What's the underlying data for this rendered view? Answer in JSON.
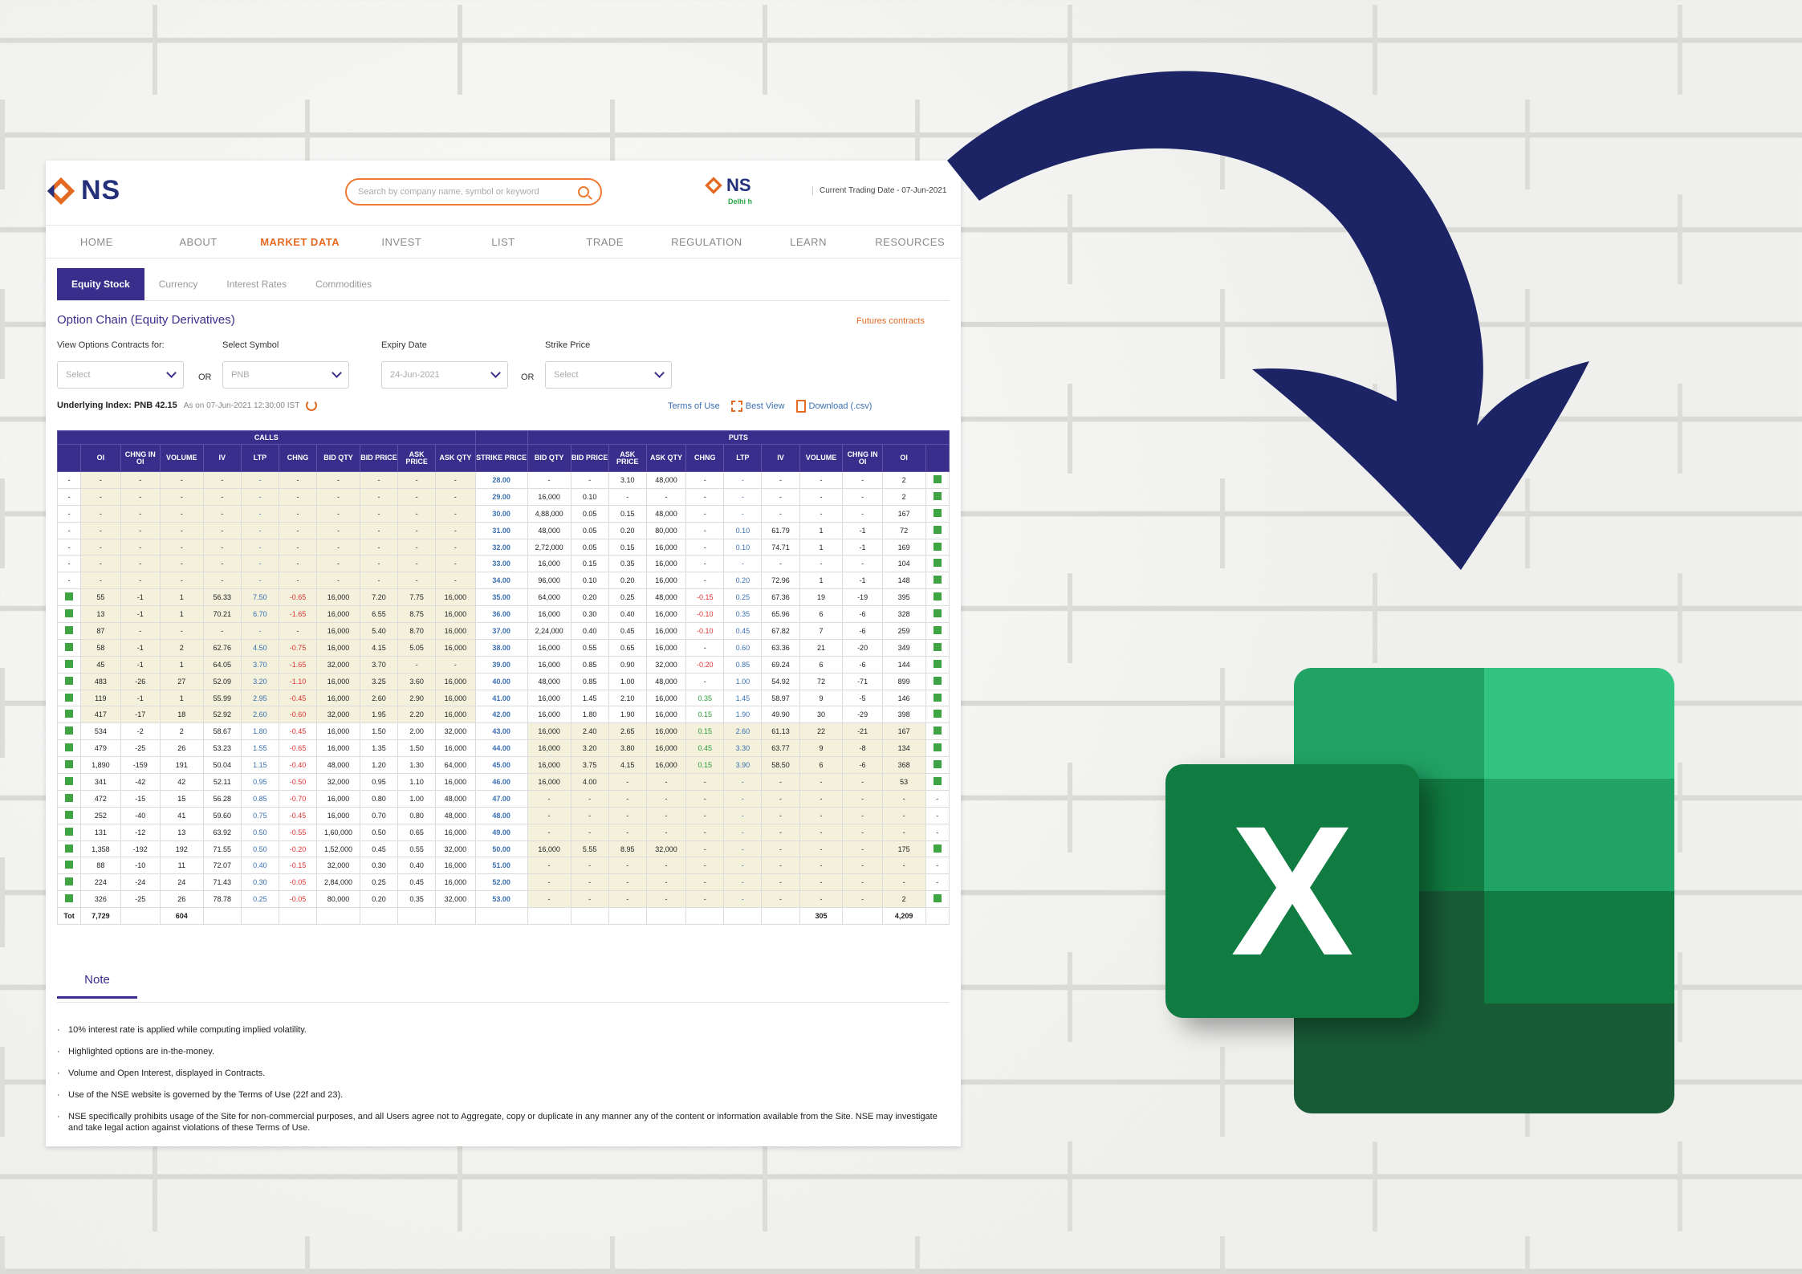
{
  "site": {
    "logo_text": "NS",
    "logo2_text": "NS",
    "logo2_tagline": "Delhi h",
    "search_placeholder": "Search by company name, symbol or keyword",
    "trading_date": "Current Trading Date - 07-Jun-2021"
  },
  "nav": [
    "HOME",
    "ABOUT",
    "MARKET DATA",
    "INVEST",
    "LIST",
    "TRADE",
    "REGULATION",
    "LEARN",
    "RESOURCES"
  ],
  "nav_active": "MARKET DATA",
  "tabs": [
    "Equity Stock",
    "Currency",
    "Interest Rates",
    "Commodities"
  ],
  "page_title": "Option Chain (Equity Derivatives)",
  "futures_link": "Futures contracts",
  "filters": {
    "contracts_label": "View Options Contracts for:",
    "contracts_value": "Select",
    "or1": "OR",
    "symbol_label": "Select Symbol",
    "symbol_value": "PNB",
    "expiry_label": "Expiry Date",
    "expiry_value": "24-Jun-2021",
    "or2": "OR",
    "strike_label": "Strike Price",
    "strike_value": "Select"
  },
  "underlying": {
    "label": "Underlying Index: PNB 42.15",
    "asof": "As on 07-Jun-2021 12:30:00 IST"
  },
  "toolbar": {
    "terms": "Terms of Use",
    "best_view": "Best View",
    "download": "Download (.csv)"
  },
  "table": {
    "calls_label": "CALLS",
    "puts_label": "PUTS",
    "columns": [
      "",
      "OI",
      "CHNG IN OI",
      "VOLUME",
      "IV",
      "LTP",
      "CHNG",
      "BID QTY",
      "BID PRICE",
      "ASK PRICE",
      "ASK QTY",
      "STRIKE PRICE",
      "BID QTY",
      "BID PRICE",
      "ASK PRICE",
      "ASK QTY",
      "CHNG",
      "LTP",
      "IV",
      "VOLUME",
      "CHNG IN OI",
      "OI",
      ""
    ],
    "itm_rows_calls_from": 7,
    "rows": [
      [
        "-",
        "-",
        "-",
        "-",
        "-",
        "-",
        "-",
        "-",
        "-",
        "-",
        "-",
        "28.00",
        "-",
        "-",
        "3.10",
        "48,000",
        "-",
        "-",
        "-",
        "-",
        "-",
        "2",
        "v"
      ],
      [
        "-",
        "-",
        "-",
        "-",
        "-",
        "-",
        "-",
        "-",
        "-",
        "-",
        "-",
        "29.00",
        "16,000",
        "0.10",
        "-",
        "-",
        "-",
        "-",
        "-",
        "-",
        "-",
        "2",
        "v"
      ],
      [
        "-",
        "-",
        "-",
        "-",
        "-",
        "-",
        "-",
        "-",
        "-",
        "-",
        "-",
        "30.00",
        "4,88,000",
        "0.05",
        "0.15",
        "48,000",
        "-",
        "-",
        "-",
        "-",
        "-",
        "167",
        "v"
      ],
      [
        "-",
        "-",
        "-",
        "-",
        "-",
        "-",
        "-",
        "-",
        "-",
        "-",
        "-",
        "31.00",
        "48,000",
        "0.05",
        "0.20",
        "80,000",
        "-",
        "0.10",
        "61.79",
        "1",
        "-1",
        "72",
        "v"
      ],
      [
        "-",
        "-",
        "-",
        "-",
        "-",
        "-",
        "-",
        "-",
        "-",
        "-",
        "-",
        "32.00",
        "2,72,000",
        "0.05",
        "0.15",
        "16,000",
        "-",
        "0.10",
        "74.71",
        "1",
        "-1",
        "169",
        "v"
      ],
      [
        "-",
        "-",
        "-",
        "-",
        "-",
        "-",
        "-",
        "-",
        "-",
        "-",
        "-",
        "33.00",
        "16,000",
        "0.15",
        "0.35",
        "16,000",
        "-",
        "-",
        "-",
        "-",
        "-",
        "104",
        "v"
      ],
      [
        "-",
        "-",
        "-",
        "-",
        "-",
        "-",
        "-",
        "-",
        "-",
        "-",
        "-",
        "34.00",
        "96,000",
        "0.10",
        "0.20",
        "16,000",
        "-",
        "0.20",
        "72.96",
        "1",
        "-1",
        "148",
        "v"
      ],
      [
        "v",
        "55",
        "-1",
        "1",
        "56.33",
        "7.50",
        "-0.65",
        "16,000",
        "7.20",
        "7.75",
        "16,000",
        "35.00",
        "64,000",
        "0.20",
        "0.25",
        "48,000",
        "-0.15",
        "0.25",
        "67.36",
        "19",
        "-19",
        "395",
        "v"
      ],
      [
        "v",
        "13",
        "-1",
        "1",
        "70.21",
        "6.70",
        "-1.65",
        "16,000",
        "6.55",
        "8.75",
        "16,000",
        "36.00",
        "16,000",
        "0.30",
        "0.40",
        "16,000",
        "-0.10",
        "0.35",
        "65.96",
        "6",
        "-6",
        "328",
        "v"
      ],
      [
        "v",
        "87",
        "-",
        "-",
        "-",
        "-",
        "-",
        "16,000",
        "5.40",
        "8.70",
        "16,000",
        "37.00",
        "2,24,000",
        "0.40",
        "0.45",
        "16,000",
        "-0.10",
        "0.45",
        "67.82",
        "7",
        "-6",
        "259",
        "v"
      ],
      [
        "v",
        "58",
        "-1",
        "2",
        "62.76",
        "4.50",
        "-0.75",
        "16,000",
        "4.15",
        "5.05",
        "16,000",
        "38.00",
        "16,000",
        "0.55",
        "0.65",
        "16,000",
        "-",
        "0.60",
        "63.36",
        "21",
        "-20",
        "349",
        "v"
      ],
      [
        "v",
        "45",
        "-1",
        "1",
        "64.05",
        "3.70",
        "-1.65",
        "32,000",
        "3.70",
        "-",
        "-",
        "39.00",
        "16,000",
        "0.85",
        "0.90",
        "32,000",
        "-0.20",
        "0.85",
        "69.24",
        "6",
        "-6",
        "144",
        "v"
      ],
      [
        "v",
        "483",
        "-26",
        "27",
        "52.09",
        "3.20",
        "-1.10",
        "16,000",
        "3.25",
        "3.60",
        "16,000",
        "40.00",
        "48,000",
        "0.85",
        "1.00",
        "48,000",
        "-",
        "1.00",
        "54.92",
        "72",
        "-71",
        "899",
        "v"
      ],
      [
        "v",
        "119",
        "-1",
        "1",
        "55.99",
        "2.95",
        "-0.45",
        "16,000",
        "2.60",
        "2.90",
        "16,000",
        "41.00",
        "16,000",
        "1.45",
        "2.10",
        "16,000",
        "0.35",
        "1.45",
        "58.97",
        "9",
        "-5",
        "146",
        "v"
      ],
      [
        "v",
        "417",
        "-17",
        "18",
        "52.92",
        "2.60",
        "-0.60",
        "32,000",
        "1.95",
        "2.20",
        "16,000",
        "42.00",
        "16,000",
        "1.80",
        "1.90",
        "16,000",
        "0.15",
        "1.90",
        "49.90",
        "30",
        "-29",
        "398",
        "v"
      ],
      [
        "v",
        "534",
        "-2",
        "2",
        "58.67",
        "1.80",
        "-0.45",
        "16,000",
        "1.50",
        "2.00",
        "32,000",
        "43.00",
        "16,000",
        "2.40",
        "2.65",
        "16,000",
        "0.15",
        "2.60",
        "61.13",
        "22",
        "-21",
        "167",
        "v"
      ],
      [
        "v",
        "479",
        "-25",
        "26",
        "53.23",
        "1.55",
        "-0.65",
        "16,000",
        "1.35",
        "1.50",
        "16,000",
        "44.00",
        "16,000",
        "3.20",
        "3.80",
        "16,000",
        "0.45",
        "3.30",
        "63.77",
        "9",
        "-8",
        "134",
        "v"
      ],
      [
        "v",
        "1,890",
        "-159",
        "191",
        "50.04",
        "1.15",
        "-0.40",
        "48,000",
        "1.20",
        "1.30",
        "64,000",
        "45.00",
        "16,000",
        "3.75",
        "4.15",
        "16,000",
        "0.15",
        "3.90",
        "58.50",
        "6",
        "-6",
        "368",
        "v"
      ],
      [
        "v",
        "341",
        "-42",
        "42",
        "52.11",
        "0.95",
        "-0.50",
        "32,000",
        "0.95",
        "1.10",
        "16,000",
        "46.00",
        "16,000",
        "4.00",
        "-",
        "-",
        "-",
        "-",
        "-",
        "-",
        "-",
        "53",
        "v"
      ],
      [
        "v",
        "472",
        "-15",
        "15",
        "56.28",
        "0.85",
        "-0.70",
        "16,000",
        "0.80",
        "1.00",
        "48,000",
        "47.00",
        "-",
        "-",
        "-",
        "-",
        "-",
        "-",
        "-",
        "-",
        "-",
        "-",
        "-"
      ],
      [
        "v",
        "252",
        "-40",
        "41",
        "59.60",
        "0.75",
        "-0.45",
        "16,000",
        "0.70",
        "0.80",
        "48,000",
        "48.00",
        "-",
        "-",
        "-",
        "-",
        "-",
        "-",
        "-",
        "-",
        "-",
        "-",
        "-"
      ],
      [
        "v",
        "131",
        "-12",
        "13",
        "63.92",
        "0.50",
        "-0.55",
        "1,60,000",
        "0.50",
        "0.65",
        "16,000",
        "49.00",
        "-",
        "-",
        "-",
        "-",
        "-",
        "-",
        "-",
        "-",
        "-",
        "-",
        "-"
      ],
      [
        "v",
        "1,358",
        "-192",
        "192",
        "71.55",
        "0.50",
        "-0.20",
        "1,52,000",
        "0.45",
        "0.55",
        "32,000",
        "50.00",
        "16,000",
        "5.55",
        "8.95",
        "32,000",
        "-",
        "-",
        "-",
        "-",
        "-",
        "175",
        "v"
      ],
      [
        "v",
        "88",
        "-10",
        "11",
        "72.07",
        "0.40",
        "-0.15",
        "32,000",
        "0.30",
        "0.40",
        "16,000",
        "51.00",
        "-",
        "-",
        "-",
        "-",
        "-",
        "-",
        "-",
        "-",
        "-",
        "-",
        "-"
      ],
      [
        "v",
        "224",
        "-24",
        "24",
        "71.43",
        "0.30",
        "-0.05",
        "2,84,000",
        "0.25",
        "0.45",
        "16,000",
        "52.00",
        "-",
        "-",
        "-",
        "-",
        "-",
        "-",
        "-",
        "-",
        "-",
        "-",
        "-"
      ],
      [
        "v",
        "326",
        "-25",
        "26",
        "78.78",
        "0.25",
        "-0.05",
        "80,000",
        "0.20",
        "0.35",
        "32,000",
        "53.00",
        "-",
        "-",
        "-",
        "-",
        "-",
        "-",
        "-",
        "-",
        "-",
        "2",
        "v"
      ]
    ],
    "total": [
      "Tot",
      "7,729",
      "",
      "604",
      "",
      "",
      "",
      "",
      "",
      "",
      "",
      "",
      "",
      "",
      "",
      "",
      "",
      "",
      "",
      "305",
      "",
      "4,209",
      ""
    ]
  },
  "note_tab": "Note",
  "notes": [
    "10% interest rate is applied while computing implied volatility.",
    "Highlighted options are in-the-money.",
    "Volume and Open Interest, displayed in Contracts.",
    "Use of the NSE website is governed by the Terms of Use (22f and 23).",
    "NSE specifically prohibits usage of the Site for non-commercial purposes, and all Users agree not to Aggregate, copy or duplicate in any manner any of the content or information available from the Site. NSE may investigate and take legal action against violations of these Terms of Use."
  ],
  "excel_letter": "X",
  "colors": {
    "nse_purple": "#3a2e8c",
    "nse_orange": "#e46a22",
    "arrow": "#1d2466",
    "excel_green": "#107c41"
  },
  "icons": [
    "search-icon",
    "refresh-icon",
    "expand-icon",
    "csv-file-icon",
    "chevron-down-icon",
    "curved-arrow-icon",
    "excel-logo-icon"
  ]
}
